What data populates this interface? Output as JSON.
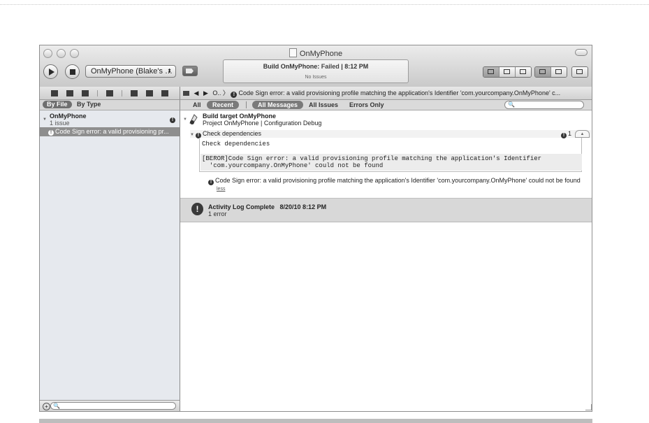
{
  "window": {
    "title": "OnMyPhone"
  },
  "toolbar": {
    "scheme": "OnMyPhone (Blake's …",
    "scheme_arrows": "⬍",
    "status": {
      "prefix": "Build OnMyPhone: ",
      "result": "Failed",
      "time": " | 8:12 PM",
      "sub": "No Issues"
    }
  },
  "navigator": {
    "filter": {
      "by_file": "By File",
      "by_type": "By Type"
    },
    "project": {
      "name": "OnMyPhone",
      "count": "1 issue",
      "badge": "!"
    },
    "selected_issue": "Code Sign error: a valid provisioning pr...",
    "bottom": {
      "add": "+",
      "search_placeholder": "🔍"
    }
  },
  "jumpbar": {
    "back": "◀",
    "forward": "▶",
    "crumb": "O..",
    "separator": "〉",
    "message": "Code Sign error: a valid provisioning profile matching the application's Identifier 'com.yourcompany.OnMyPhone' c..."
  },
  "scope": {
    "all": "All",
    "recent": "Recent",
    "all_messages": "All Messages",
    "all_issues": "All Issues",
    "errors_only": "Errors Only",
    "search_placeholder": "🔍"
  },
  "log": {
    "build_target": "Build target OnMyPhone",
    "build_detail": "Project  OnMyPhone | Configuration  Debug",
    "check_title": "Check dependencies",
    "check_count": "1",
    "mono_line1": "Check dependencies",
    "mono_line2a": "[BEROR]Code Sign error: a valid provisioning profile matching the application's Identifier",
    "mono_line2b": "  'com.yourcompany.OnMyPhone' could not be found",
    "error_text": "Code Sign error: a valid provisioning profile matching the application's Identifier 'com.yourcompany.OnMyPhone' could not be found",
    "less": "less",
    "activity_title": "Activity Log Complete",
    "activity_time": "8/20/10 8:12 PM",
    "activity_sub": "1 error",
    "activity_badge": "!"
  },
  "colors": {
    "selection": "#8e8e8e",
    "navigator_bg": "#e6e9ee",
    "activity_bg": "#d8d8d8"
  }
}
